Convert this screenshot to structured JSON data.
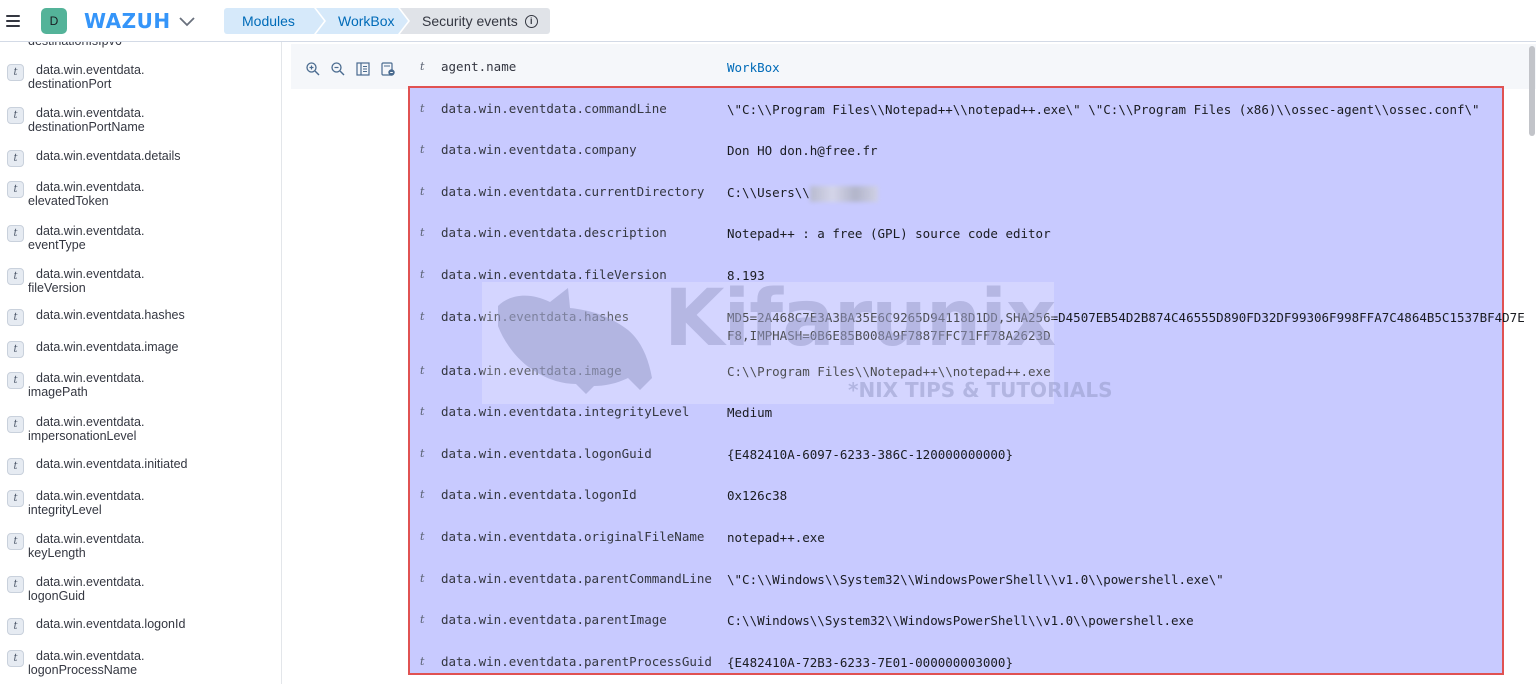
{
  "header": {
    "space_initial": "D",
    "app_name": "WAZUH",
    "menu_icon": "hamburger-icon",
    "breadcrumbs": [
      {
        "label": "Modules"
      },
      {
        "label": "WorkBox"
      },
      {
        "label": "Security events"
      }
    ],
    "info_glyph": "i"
  },
  "sidebar": {
    "partial_top_label": "destinationIsIpv6",
    "items": [
      {
        "type": "t",
        "line1": "data.win.eventdata.",
        "line2": "destinationPort"
      },
      {
        "type": "t",
        "line1": "data.win.eventdata.",
        "line2": "destinationPortName"
      },
      {
        "type": "t",
        "line1": "data.win.eventdata.details",
        "line2": ""
      },
      {
        "type": "t",
        "line1": "data.win.eventdata.",
        "line2": "elevatedToken"
      },
      {
        "type": "t",
        "line1": "data.win.eventdata.",
        "line2": "eventType"
      },
      {
        "type": "t",
        "line1": "data.win.eventdata.",
        "line2": "fileVersion"
      },
      {
        "type": "t",
        "line1": "data.win.eventdata.hashes",
        "line2": ""
      },
      {
        "type": "t",
        "line1": "data.win.eventdata.image",
        "line2": ""
      },
      {
        "type": "t",
        "line1": "data.win.eventdata.",
        "line2": "imagePath"
      },
      {
        "type": "t",
        "line1": "data.win.eventdata.",
        "line2": "impersonationLevel"
      },
      {
        "type": "t",
        "line1": "data.win.eventdata.initiated",
        "line2": ""
      },
      {
        "type": "t",
        "line1": "data.win.eventdata.",
        "line2": "integrityLevel"
      },
      {
        "type": "t",
        "line1": "data.win.eventdata.",
        "line2": "keyLength"
      },
      {
        "type": "t",
        "line1": "data.win.eventdata.",
        "line2": "logonGuid"
      },
      {
        "type": "t",
        "line1": "data.win.eventdata.logonId",
        "line2": ""
      },
      {
        "type": "t",
        "line1": "data.win.eventdata.",
        "line2": "logonProcessName"
      }
    ]
  },
  "doc": {
    "action_icons": [
      "zoom-in-icon",
      "zoom-out-icon",
      "toggle-column-icon",
      "filter-exists-icon"
    ],
    "fields": [
      {
        "type": "t",
        "name": "agent.name",
        "value": "WorkBox"
      },
      {
        "type": "t",
        "name": "data.win.eventdata.commandLine",
        "value": "\\\"C:\\\\Program Files\\\\Notepad++\\\\notepad++.exe\\\" \\\"C:\\\\Program Files (x86)\\\\ossec-agent\\\\ossec.conf\\\""
      },
      {
        "type": "t",
        "name": "data.win.eventdata.company",
        "value": "Don HO don.h@free.fr"
      },
      {
        "type": "t",
        "name": "data.win.eventdata.currentDirectory",
        "value": "C:\\\\Users\\\\"
      },
      {
        "type": "t",
        "name": "data.win.eventdata.description",
        "value": "Notepad++ : a free (GPL) source code editor"
      },
      {
        "type": "t",
        "name": "data.win.eventdata.fileVersion",
        "value": "8.193"
      },
      {
        "type": "t",
        "name": "data.win.eventdata.hashes",
        "value": "MD5=2A468C7E3A3BA35E6C9265D94118D1DD,SHA256=D4507EB54D2B874C46555D890FD32DF99306F998FFA7C4864B5C1537BF4D7EF8,IMPHASH=0B6E85B008A9F7887FFC71FF78A2623D"
      },
      {
        "type": "t",
        "name": "data.win.eventdata.image",
        "value": "C:\\\\Program Files\\\\Notepad++\\\\notepad++.exe"
      },
      {
        "type": "t",
        "name": "data.win.eventdata.integrityLevel",
        "value": "Medium"
      },
      {
        "type": "t",
        "name": "data.win.eventdata.logonGuid",
        "value": "{E482410A-6097-6233-386C-120000000000}"
      },
      {
        "type": "t",
        "name": "data.win.eventdata.logonId",
        "value": "0x126c38"
      },
      {
        "type": "t",
        "name": "data.win.eventdata.originalFileName",
        "value": "notepad++.exe"
      },
      {
        "type": "t",
        "name": "data.win.eventdata.parentCommandLine",
        "value": "\\\"C:\\\\Windows\\\\System32\\\\WindowsPowerShell\\\\v1.0\\\\powershell.exe\\\""
      },
      {
        "type": "t",
        "name": "data.win.eventdata.parentImage",
        "value": "C:\\\\Windows\\\\System32\\\\WindowsPowerShell\\\\v1.0\\\\powershell.exe"
      },
      {
        "type": "t",
        "name": "data.win.eventdata.parentProcessGuid",
        "value": "{E482410A-72B3-6233-7E01-000000003000}"
      }
    ]
  },
  "watermark": {
    "brand": "Kifarunix",
    "tagline": "*NIX TIPS & TUTORIALS"
  },
  "colors": {
    "brand_blue": "#3595f9",
    "link_blue": "#006bb8",
    "selection_fill": "#c8caff",
    "selection_border": "#e05252",
    "avatar_green": "#54b399"
  }
}
